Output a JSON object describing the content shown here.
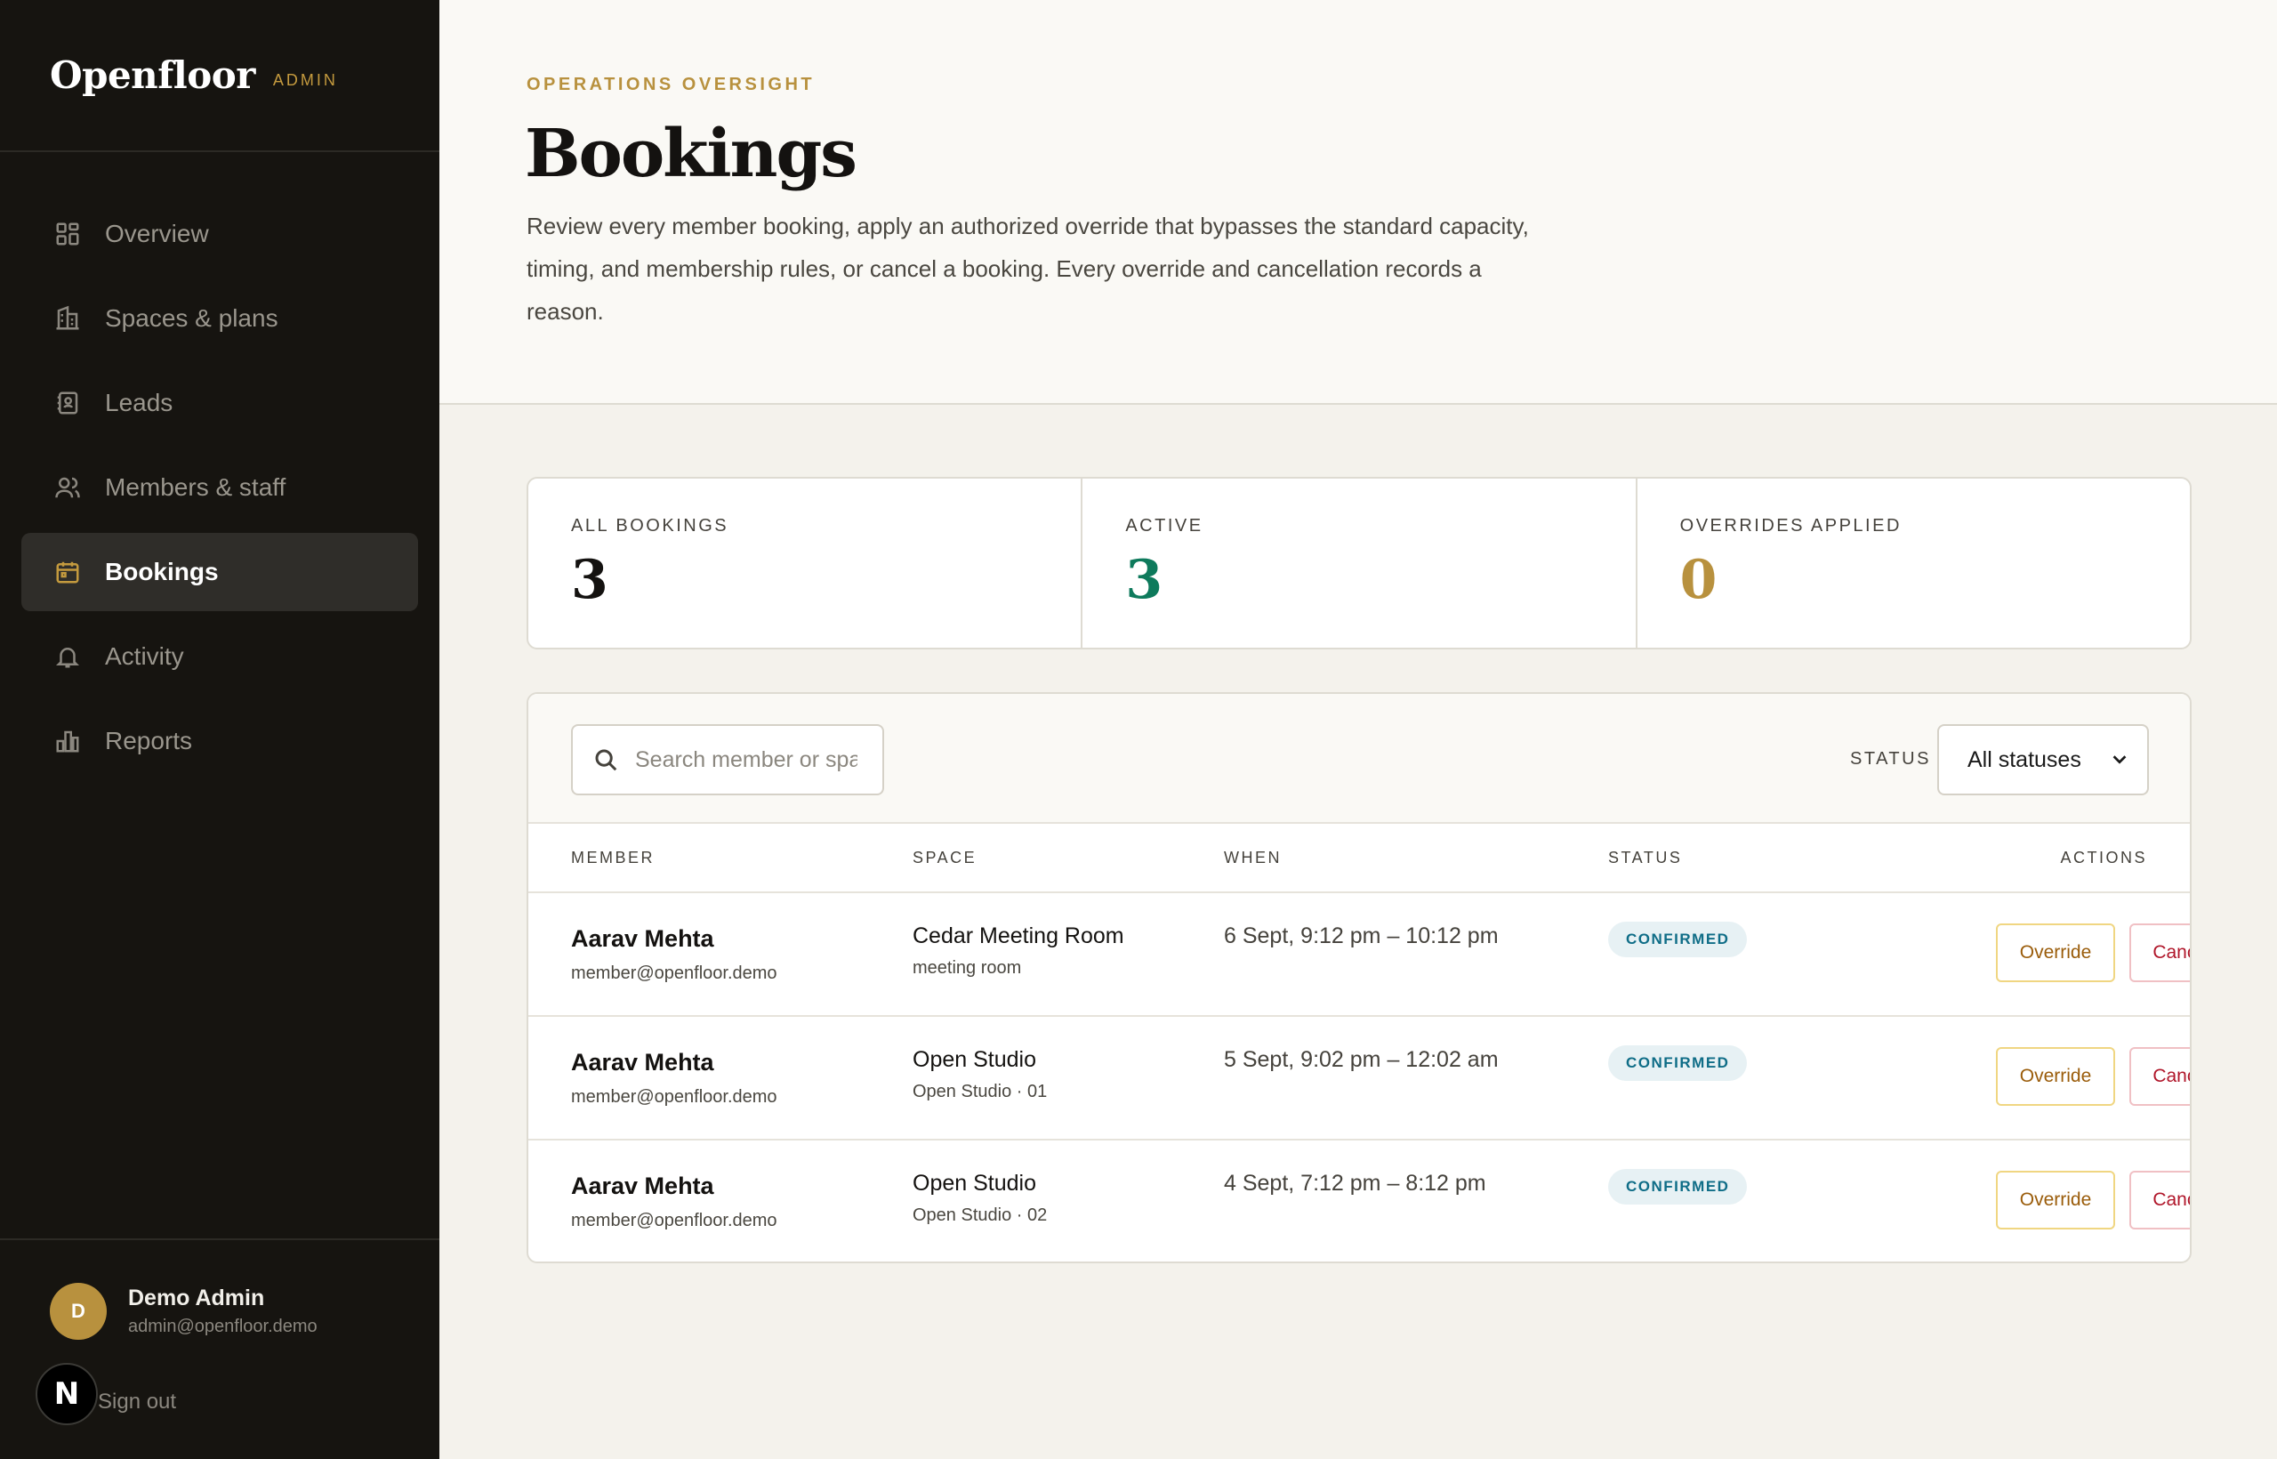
{
  "brand": {
    "name": "Openfloor",
    "tag": "ADMIN"
  },
  "nav": [
    {
      "label": "Overview",
      "icon": "grid-icon"
    },
    {
      "label": "Spaces & plans",
      "icon": "building-icon"
    },
    {
      "label": "Leads",
      "icon": "contact-card-icon"
    },
    {
      "label": "Members & staff",
      "icon": "users-icon"
    },
    {
      "label": "Bookings",
      "icon": "calendar-icon",
      "active": true
    },
    {
      "label": "Activity",
      "icon": "bell-icon"
    },
    {
      "label": "Reports",
      "icon": "bar-chart-icon"
    }
  ],
  "user": {
    "initial": "D",
    "name": "Demo Admin",
    "email": "admin@openfloor.demo",
    "signout": "Sign out",
    "badge": "N"
  },
  "header": {
    "eyebrow": "OPERATIONS OVERSIGHT",
    "title": "Bookings",
    "description": "Review every member booking, apply an authorized override that bypasses the standard capacity, timing, and membership rules, or cancel a booking. Every override and cancellation records a reason."
  },
  "stats": [
    {
      "label": "ALL BOOKINGS",
      "value": "3",
      "color": "#141210"
    },
    {
      "label": "ACTIVE",
      "value": "3",
      "color": "#0e7a5c"
    },
    {
      "label": "OVERRIDES APPLIED",
      "value": "0",
      "color": "#b8913e"
    }
  ],
  "toolbar": {
    "search_placeholder": "Search member or spa",
    "status_label": "STATUS",
    "status_selected": "All statuses"
  },
  "table": {
    "columns": {
      "member": "MEMBER",
      "space": "SPACE",
      "when": "WHEN",
      "status": "STATUS",
      "actions": "ACTIONS"
    },
    "rows": [
      {
        "member": "Aarav Mehta",
        "email": "member@openfloor.demo",
        "space": "Cedar Meeting Room",
        "space_sub": "meeting room",
        "when": "6 Sept, 9:12 pm – 10:12 pm",
        "status": "CONFIRMED",
        "override": "Override",
        "cancel": "Cancel"
      },
      {
        "member": "Aarav Mehta",
        "email": "member@openfloor.demo",
        "space": "Open Studio",
        "space_sub": "Open Studio · 01",
        "when": "5 Sept, 9:02 pm – 12:02 am",
        "status": "CONFIRMED",
        "override": "Override",
        "cancel": "Cancel"
      },
      {
        "member": "Aarav Mehta",
        "email": "member@openfloor.demo",
        "space": "Open Studio",
        "space_sub": "Open Studio · 02",
        "when": "4 Sept, 7:12 pm – 8:12 pm",
        "status": "CONFIRMED",
        "override": "Override",
        "cancel": "Cancel"
      }
    ]
  }
}
